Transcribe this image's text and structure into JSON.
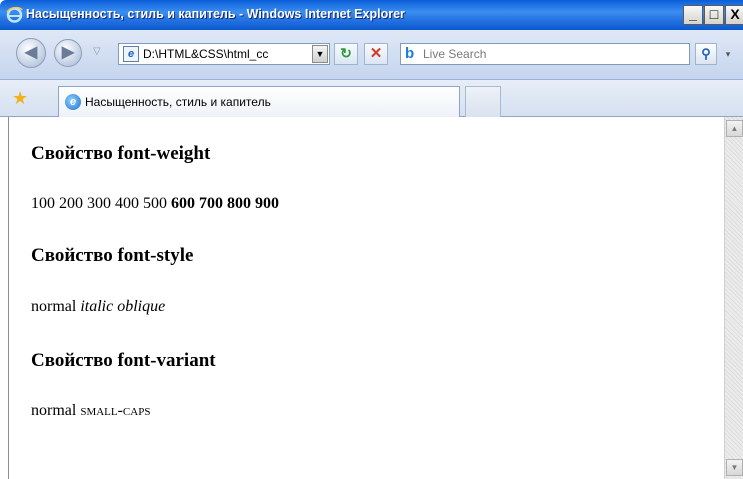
{
  "window": {
    "title": "Насыщенность, стиль и капитель - Windows Internet Explorer",
    "minimize": "_",
    "maximize": "□",
    "close": "X"
  },
  "nav": {
    "back": "◀",
    "forward": "▶",
    "recent": "▽",
    "address_value": "D:\\HTML&CSS\\html_cc",
    "address_dropdown": "▼",
    "refresh": "↻",
    "stop": "✕",
    "search_placeholder": "Live Search",
    "search_button": "⚲",
    "search_dropdown": "▾"
  },
  "tabs": {
    "active_label": "Насыщенность, стиль и капитель"
  },
  "content": {
    "sections": [
      {
        "heading": "Свойство font-weight",
        "weights": [
          "100",
          "200",
          "300",
          "400",
          "500",
          "600",
          "700",
          "800",
          "900"
        ]
      },
      {
        "heading": "Свойство font-style",
        "normal": "normal",
        "italic": "italic",
        "oblique": "oblique"
      },
      {
        "heading": "Свойство font-variant",
        "normal": "normal",
        "small_caps": "small-caps"
      }
    ]
  },
  "icons": {
    "ie_logo": "ie-logo-icon",
    "favorites": "star-icon",
    "page": "page-icon",
    "live_search": "live-search-icon"
  },
  "colors": {
    "titlebar": "#0a5dd8",
    "toolbar": "#c5d5ee",
    "content_bg": "#ffffff"
  }
}
